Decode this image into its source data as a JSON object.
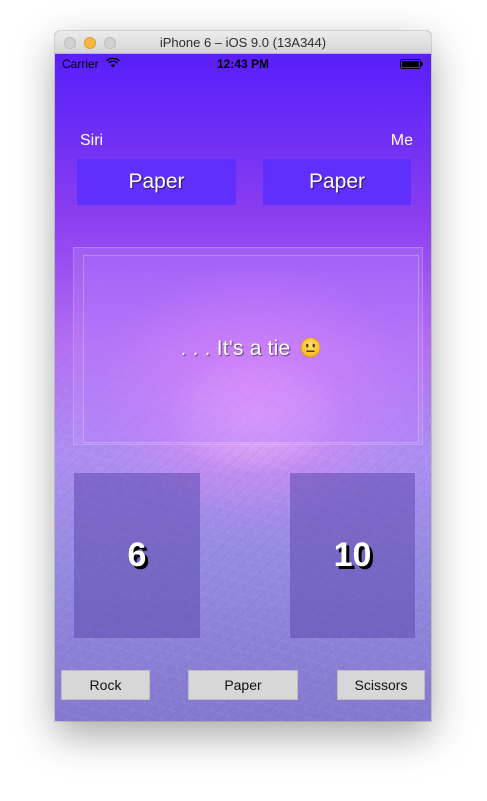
{
  "window": {
    "title": "iPhone 6 – iOS 9.0 (13A344)"
  },
  "status_bar": {
    "carrier": "Carrier",
    "time": "12:43 PM"
  },
  "players": {
    "left_label": "Siri",
    "right_label": "Me"
  },
  "choices": {
    "siri_choice": "Paper",
    "my_choice": "Paper"
  },
  "result": {
    "text": ". . . It's a tie",
    "emoji_icon": "neutral-face-icon"
  },
  "scores": {
    "siri": "6",
    "me": "10"
  },
  "buttons": {
    "rock": "Rock",
    "paper": "Paper",
    "scissors": "Scissors"
  },
  "colors": {
    "choice_box": "#552dff",
    "button_bg": "#d7d7d7",
    "traffic_minimize": "#f5b93e"
  }
}
